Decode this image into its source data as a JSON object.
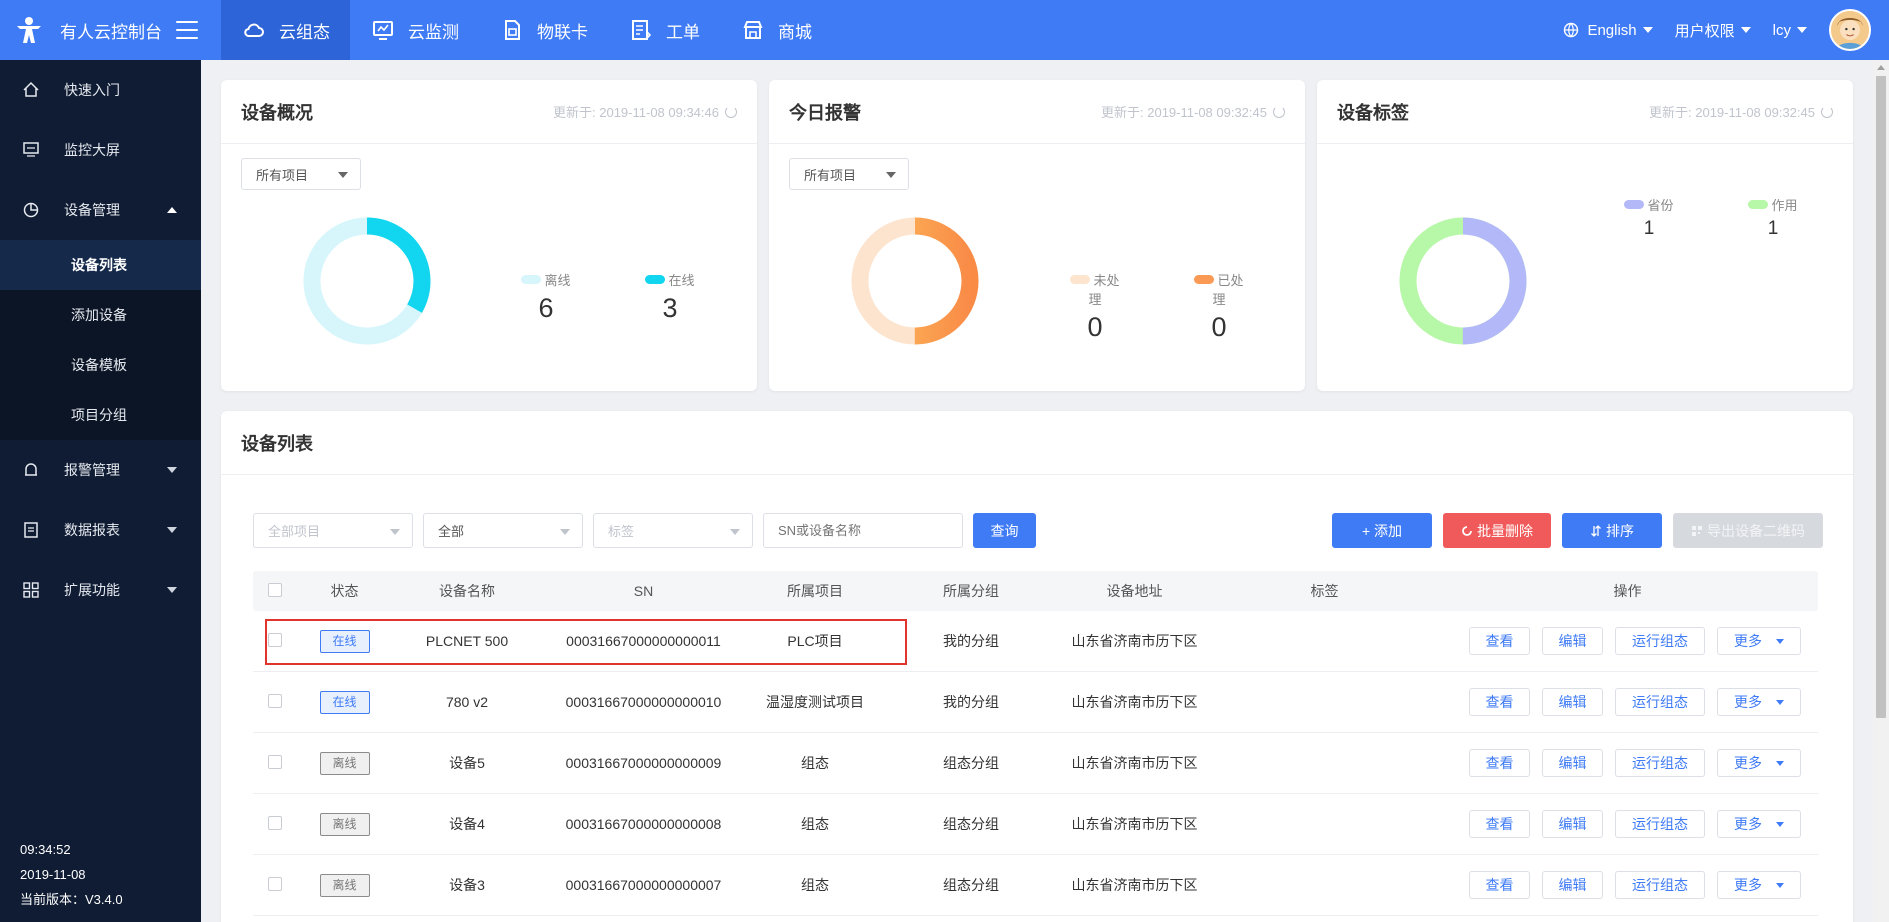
{
  "brand": {
    "title": "有人云控制台"
  },
  "topnav": [
    {
      "label": "云组态",
      "icon": "cloud-icon",
      "active": true
    },
    {
      "label": "云监测",
      "icon": "monitor-icon",
      "active": false
    },
    {
      "label": "物联卡",
      "icon": "sim-card-icon",
      "active": false
    },
    {
      "label": "工单",
      "icon": "work-order-icon",
      "active": false
    },
    {
      "label": "商城",
      "icon": "shop-icon",
      "active": false
    }
  ],
  "topright": {
    "language": "English",
    "permissions": "用户权限",
    "user": "lcy"
  },
  "sidebar": {
    "items": [
      {
        "label": "快速入门",
        "icon": "home-icon"
      },
      {
        "label": "监控大屏",
        "icon": "screen-icon"
      },
      {
        "label": "设备管理",
        "icon": "device-icon"
      },
      {
        "label": "报警管理",
        "icon": "bell-icon"
      },
      {
        "label": "数据报表",
        "icon": "report-icon"
      },
      {
        "label": "扩展功能",
        "icon": "grid-icon"
      }
    ],
    "subitems": [
      "设备列表",
      "添加设备",
      "设备模板",
      "项目分组"
    ],
    "footer": {
      "time": "09:34:52",
      "date": "2019-11-08",
      "version": "当前版本：V3.4.0"
    }
  },
  "overview": {
    "title": "设备概况",
    "updated": "更新于: 2019-11-08 09:34:46",
    "filter": "所有项目",
    "legend": [
      {
        "label": "离线",
        "value": "6",
        "color": "#d6f6fb"
      },
      {
        "label": "在线",
        "value": "3",
        "color": "#12d6ef"
      }
    ]
  },
  "alarms": {
    "title": "今日报警",
    "updated": "更新于: 2019-11-08 09:32:45",
    "filter": "所有项目",
    "legend": [
      {
        "label": "未处理",
        "value": "0",
        "color": "#fde4cf"
      },
      {
        "label": "已处理",
        "value": "0",
        "color": "#fb9a55"
      }
    ]
  },
  "tags": {
    "title": "设备标签",
    "updated": "更新于: 2019-11-08 09:32:45",
    "legend": [
      {
        "label": "省份",
        "value": "1",
        "color": "#b3b8f8"
      },
      {
        "label": "作用",
        "value": "1",
        "color": "#b7f7a8"
      }
    ]
  },
  "device_list": {
    "title": "设备列表",
    "filters": {
      "project": "全部项目",
      "status": "全部",
      "tag": "标签",
      "search_placeholder": "SN或设备名称",
      "query": "查询"
    },
    "actions": {
      "add": "+ 添加",
      "batch_delete": "批量删除",
      "sort": "排序",
      "export_qr": "导出设备二维码"
    },
    "columns": [
      "状态",
      "设备名称",
      "SN",
      "所属项目",
      "所属分组",
      "设备地址",
      "标签",
      "操作"
    ],
    "ops": {
      "view": "查看",
      "edit": "编辑",
      "run": "运行组态",
      "more": "更多"
    },
    "rows": [
      {
        "status": "在线",
        "online": true,
        "name": "PLCNET 500",
        "sn": "00031667000000000011",
        "project": "PLC项目",
        "group": "我的分组",
        "address": "山东省济南市历下区",
        "tag": ""
      },
      {
        "status": "在线",
        "online": true,
        "name": "780 v2",
        "sn": "00031667000000000010",
        "project": "温湿度测试项目",
        "group": "我的分组",
        "address": "山东省济南市历下区",
        "tag": ""
      },
      {
        "status": "离线",
        "online": false,
        "name": "设备5",
        "sn": "00031667000000000009",
        "project": "组态",
        "group": "组态分组",
        "address": "山东省济南市历下区",
        "tag": ""
      },
      {
        "status": "离线",
        "online": false,
        "name": "设备4",
        "sn": "00031667000000000008",
        "project": "组态",
        "group": "组态分组",
        "address": "山东省济南市历下区",
        "tag": ""
      },
      {
        "status": "离线",
        "online": false,
        "name": "设备3",
        "sn": "00031667000000000007",
        "project": "组态",
        "group": "组态分组",
        "address": "山东省济南市历下区",
        "tag": ""
      }
    ]
  }
}
